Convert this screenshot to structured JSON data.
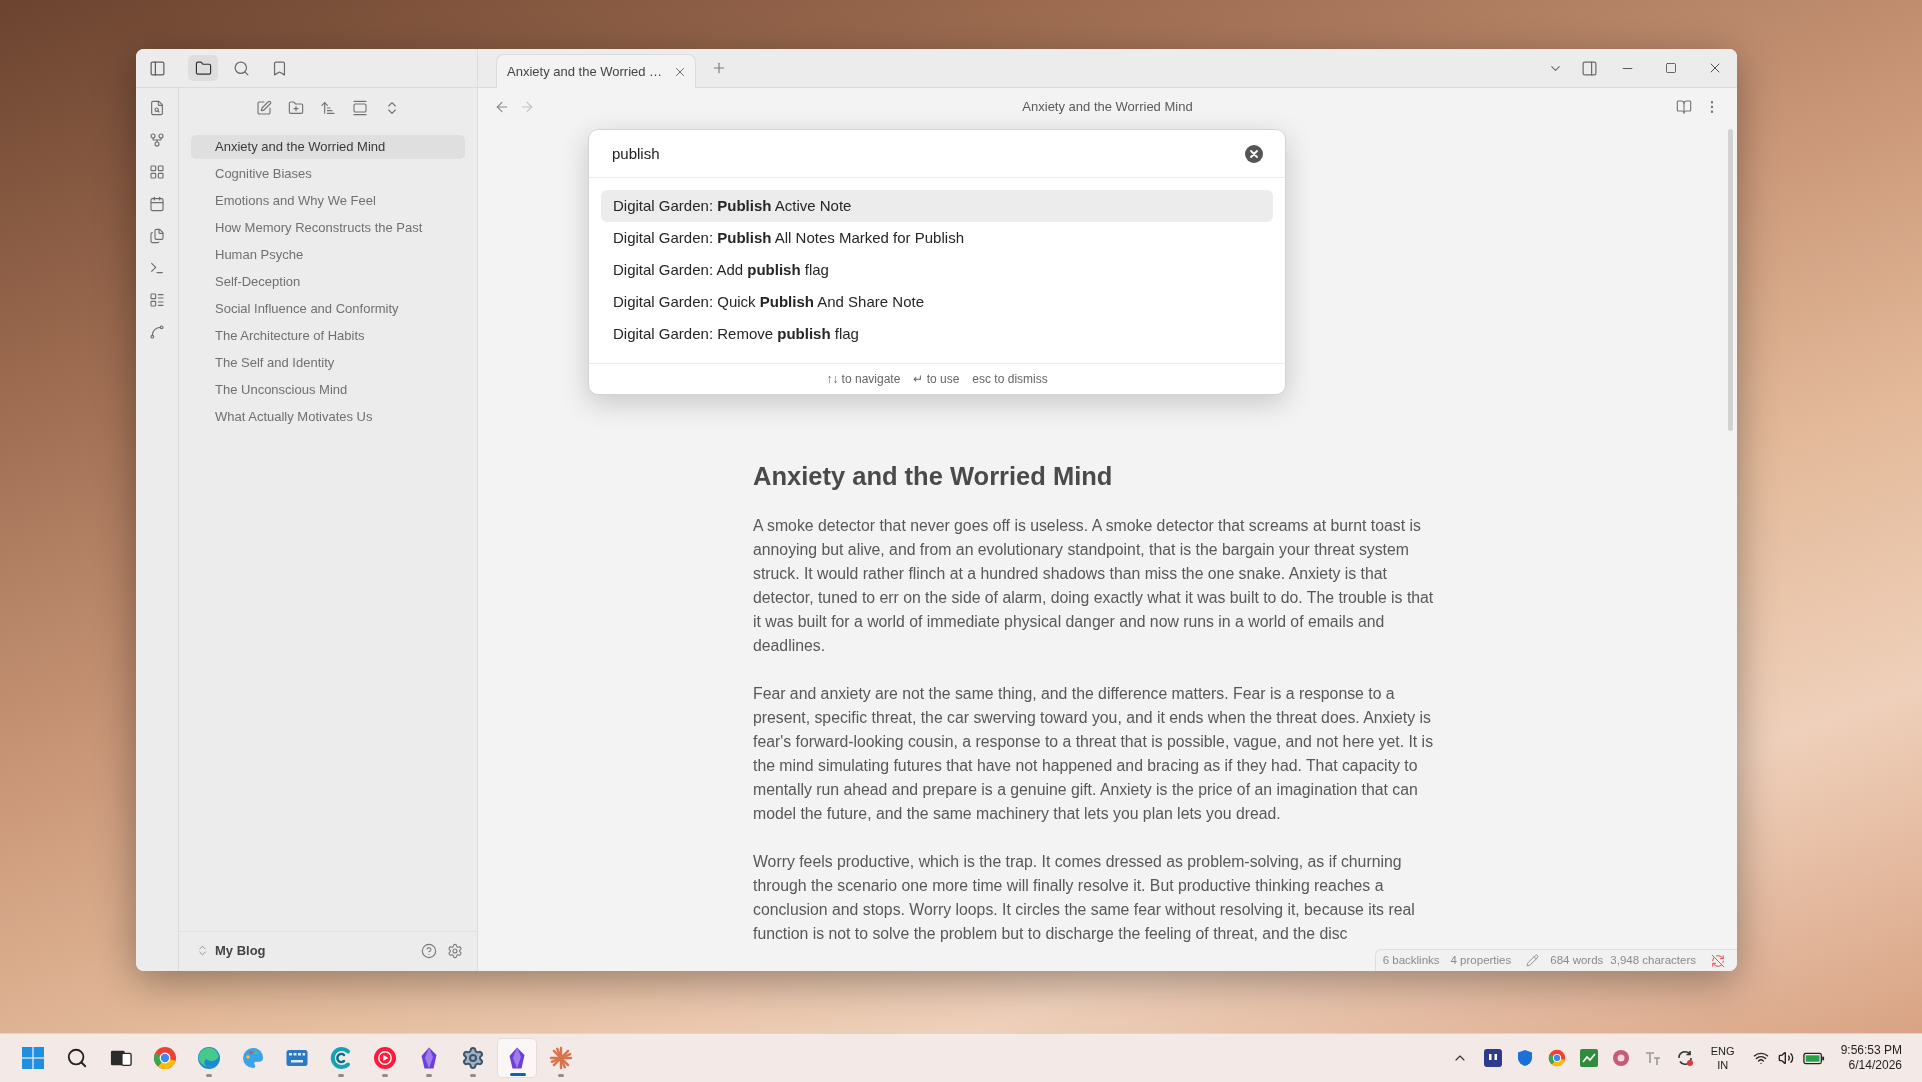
{
  "sidebar": {
    "tabs": [
      {
        "kind": "folder",
        "selected": true
      },
      {
        "kind": "search",
        "selected": false
      },
      {
        "kind": "bookmark",
        "selected": false
      }
    ],
    "files": [
      {
        "title": "Anxiety and the Worried Mind",
        "selected": true
      },
      {
        "title": "Cognitive Biases",
        "selected": false
      },
      {
        "title": "Emotions and Why We Feel",
        "selected": false
      },
      {
        "title": "How Memory Reconstructs the Past",
        "selected": false
      },
      {
        "title": "Human Psyche",
        "selected": false
      },
      {
        "title": "Self-Deception",
        "selected": false
      },
      {
        "title": "Social Influence and Conformity",
        "selected": false
      },
      {
        "title": "The Architecture of Habits",
        "selected": false
      },
      {
        "title": "The Self and Identity",
        "selected": false
      },
      {
        "title": "The Unconscious Mind",
        "selected": false
      },
      {
        "title": "What Actually Motivates Us",
        "selected": false
      }
    ],
    "vault": "My Blog"
  },
  "tabs": [
    {
      "title": "Anxiety and the Worried …",
      "selected": true
    }
  ],
  "navigation": [
    {
      "kind": "back",
      "disabled": false
    },
    {
      "kind": "forward",
      "disabled": true
    }
  ],
  "view_header": {
    "title": "Anxiety and the Worried Mind"
  },
  "command_palette": {
    "query": "publish",
    "results": [
      {
        "text": "Digital Garden: **Publish** Active Note",
        "selected": true
      },
      {
        "text": "Digital Garden: **Publish** All Notes Marked for Publish",
        "selected": false
      },
      {
        "text": "Digital Garden: Add **publish** flag",
        "selected": false
      },
      {
        "text": "Digital Garden: Quick **Publish** And Share Note",
        "selected": false
      },
      {
        "text": "Digital Garden: Remove **publish** flag",
        "selected": false
      }
    ],
    "hints": [
      "↑↓ to navigate",
      "↵ to use",
      "esc to dismiss"
    ]
  },
  "document": {
    "heading": "Anxiety and the Worried Mind",
    "paragraphs": [
      "A smoke detector that never goes off is useless. A smoke detector that screams at burnt toast is annoying but alive, and from an evolutionary standpoint, that is the bargain your threat system struck. It would rather flinch at a hundred shadows than miss the one snake. Anxiety is that detector, tuned to err on the side of alarm, doing exactly what it was built to do. The trouble is that it was built for a world of immediate physical danger and now runs in a world of emails and deadlines.",
      "Fear and anxiety are not the same thing, and the difference matters. Fear is a response to a present, specific threat, the car swerving toward you, and it ends when the threat does. Anxiety is fear's forward-looking cousin, a response to a threat that is possible, vague, and not here yet. It is the mind simulating futures that have not happened and bracing as if they had. That capacity to mentally run ahead and prepare is a genuine gift. Anxiety is the price of an imagination that can model the future, and the same machinery that lets you plan lets you dread.",
      "Worry feels productive, which is the trap. It comes dressed as problem-solving, as if churning through the scenario one more time will finally resolve it. But productive thinking reaches a conclusion and stops. Worry loops. It circles the same fear without resolving it, because its real function is not to solve the problem but to discharge the feeling of threat, and the disc"
    ]
  },
  "status_bar": {
    "backlinks": "6 backlinks",
    "properties": "4 properties",
    "words": "684 words",
    "characters": "3,948 characters"
  },
  "taskbar": {
    "apps": [
      {
        "kind": "color-ring",
        "running": false,
        "selected": false
      },
      {
        "kind": "swirl",
        "running": true,
        "selected": false
      },
      {
        "kind": "palette",
        "running": false,
        "selected": false
      },
      {
        "kind": "keyboard",
        "running": false,
        "selected": false
      },
      {
        "kind": "crescent",
        "running": true,
        "selected": false
      },
      {
        "kind": "play",
        "running": true,
        "selected": false
      },
      {
        "kind": "crystal",
        "running": true,
        "selected": false
      },
      {
        "kind": "gear",
        "running": true,
        "selected": false
      },
      {
        "kind": "crystal",
        "running": true,
        "selected": true
      },
      {
        "kind": "starburst",
        "running": true,
        "selected": false
      }
    ],
    "language": "ENG",
    "region": "IN",
    "time": "9:56:53 PM",
    "date": "6/14/2026"
  }
}
